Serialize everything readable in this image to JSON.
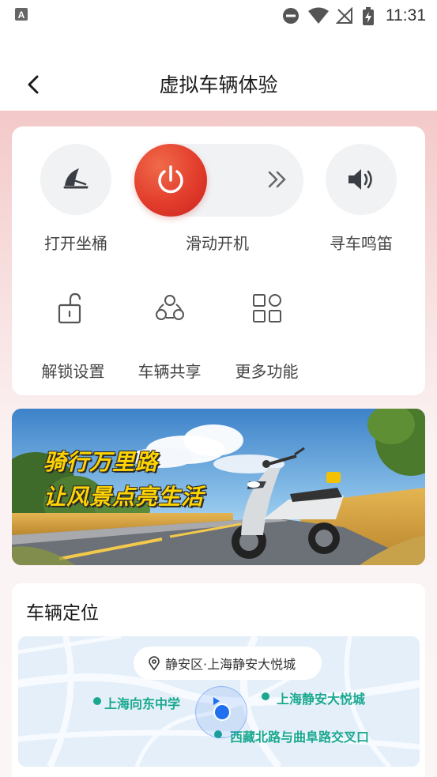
{
  "status_bar": {
    "time": "11:31"
  },
  "header": {
    "title": "虚拟车辆体验"
  },
  "controls": {
    "seat_button_label": "打开坐桶",
    "slide_label": "滑动开机",
    "horn_button_label": "寻车鸣笛",
    "unlock_settings_label": "解锁设置",
    "vehicle_share_label": "车辆共享",
    "more_label": "更多功能"
  },
  "banner": {
    "line1": "骑行万里路",
    "line2": "让风景点亮生活"
  },
  "location": {
    "title": "车辆定位",
    "address": "静安区·上海静安大悦城",
    "poi_1": "上海向东中学",
    "poi_2": "上海静安大悦城",
    "poi_3": "西藏北路与曲阜路交叉口"
  },
  "colors": {
    "accent_red": "#e23d2c",
    "poi_green": "#19a88f",
    "location_blue": "#1f6ff0"
  }
}
